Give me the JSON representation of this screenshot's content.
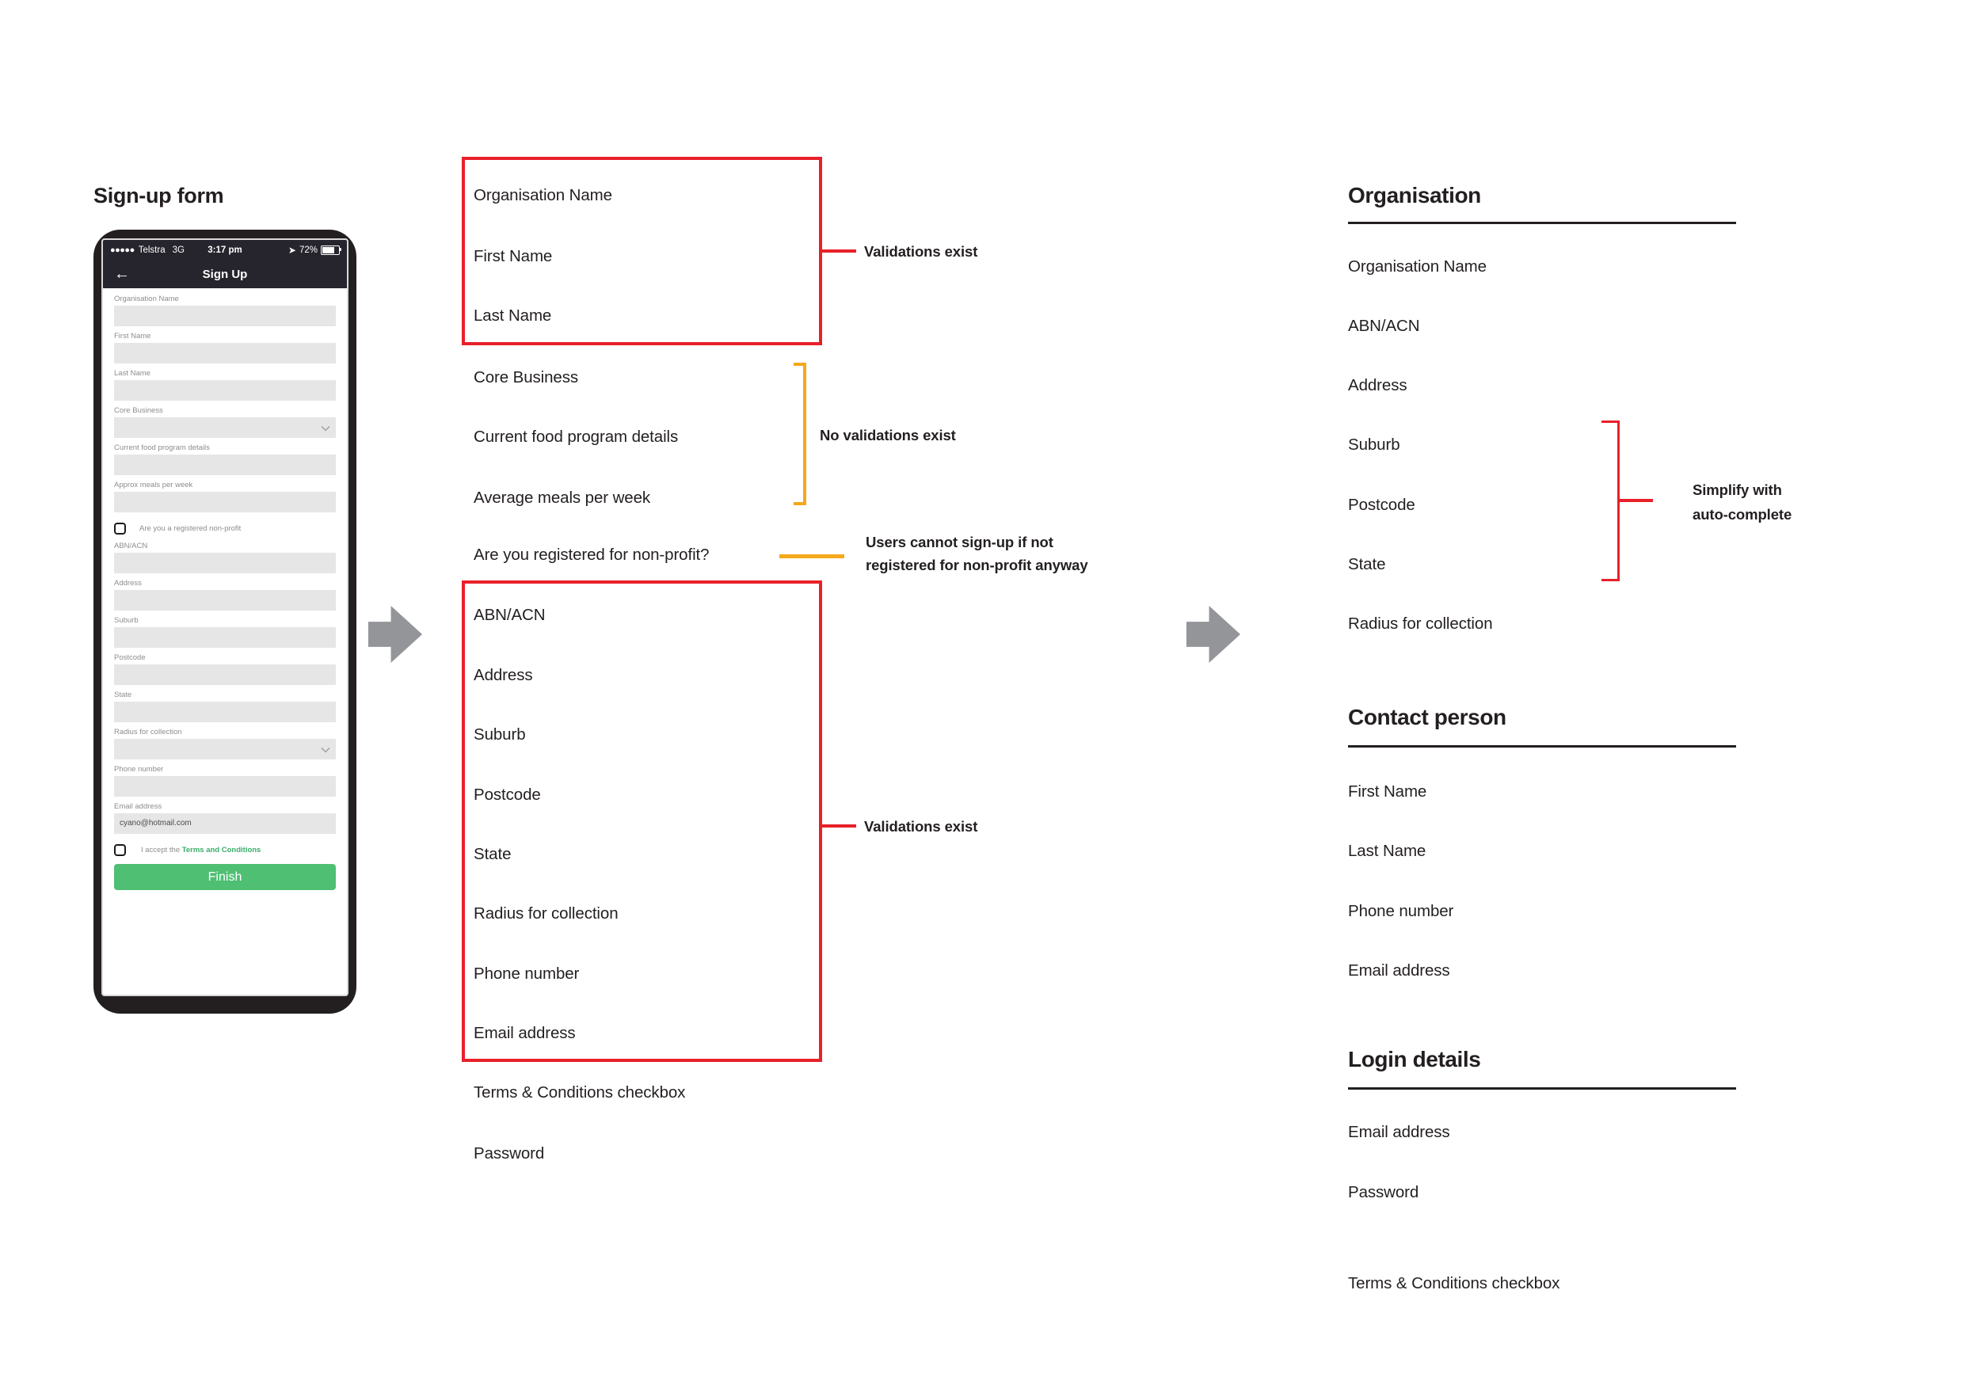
{
  "left": {
    "title": "Sign-up form",
    "phone": {
      "status_bar": {
        "signal_dots": "●●●●●",
        "carrier": "Telstra",
        "network": "3G",
        "time": "3:17 pm",
        "location_icon": "location-arrow-icon",
        "battery_percent": "72%"
      },
      "nav": {
        "back_icon": "back-arrow-icon",
        "title": "Sign Up"
      },
      "fields": [
        {
          "label": "Organisation Name",
          "value": "",
          "type": "text"
        },
        {
          "label": "First Name",
          "value": "",
          "type": "text"
        },
        {
          "label": "Last Name",
          "value": "",
          "type": "text"
        },
        {
          "label": "Core Business",
          "value": "",
          "type": "select"
        },
        {
          "label": "Current food program details",
          "value": "",
          "type": "text"
        },
        {
          "label": "Approx meals per week",
          "value": "",
          "type": "text"
        }
      ],
      "nonprofit_checkbox": {
        "label": "Are you a registered non-profit",
        "checked": false
      },
      "fields2": [
        {
          "label": "ABN/ACN",
          "value": "",
          "type": "text"
        },
        {
          "label": "Address",
          "value": "",
          "type": "text"
        },
        {
          "label": "Suburb",
          "value": "",
          "type": "text"
        },
        {
          "label": "Postcode",
          "value": "",
          "type": "text"
        },
        {
          "label": "State",
          "value": "",
          "type": "text"
        },
        {
          "label": "Radius for collection",
          "value": "",
          "type": "select"
        },
        {
          "label": "Phone number",
          "value": "",
          "type": "text"
        },
        {
          "label": "Email address",
          "value": "cyano@hotmail.com",
          "type": "text"
        }
      ],
      "terms_checkbox": {
        "prefix": "I accept the ",
        "link": "Terms and Conditions",
        "checked": false
      },
      "finish_button": "Finish"
    }
  },
  "middle": {
    "group1": [
      "Organisation Name",
      "First Name",
      "Last Name"
    ],
    "group1_note": "Validations exist",
    "group2": [
      "Core Business",
      "Current food program details",
      "Average meals per week"
    ],
    "group2_note": "No validations exist",
    "group3": [
      "Are you registered for non-profit?"
    ],
    "group3_note_line1": "Users cannot sign-up if not",
    "group3_note_line2": "registered for non-profit anyway",
    "group4": [
      "ABN/ACN",
      "Address",
      "Suburb",
      "Postcode",
      "State",
      "Radius for collection",
      "Phone number",
      "Email address"
    ],
    "group4_note": "Validations exist",
    "group5": [
      "Terms & Conditions checkbox",
      "Password"
    ]
  },
  "right": {
    "sections": [
      {
        "heading": "Organisation",
        "items": [
          "Organisation Name",
          "ABN/ACN",
          "Address",
          "Suburb",
          "Postcode",
          "State",
          "Radius for collection"
        ]
      },
      {
        "heading": "Contact person",
        "items": [
          "First Name",
          "Last Name",
          "Phone number",
          "Email address"
        ]
      },
      {
        "heading": "Login details",
        "items": [
          "Email address",
          "Password",
          "Terms & Conditions checkbox"
        ]
      }
    ],
    "annotation_line1": "Simplify with",
    "annotation_line2": "auto-complete"
  },
  "colors": {
    "red": "#E8202A",
    "orange": "#F5A81C",
    "arrow_grey": "#939598",
    "button_green": "#4FBF73",
    "link_green": "#3AAE6A",
    "phone_body": "#231F20",
    "input_grey": "#E6E6E6"
  },
  "icons": {
    "arrow_1": "right-arrow-icon",
    "arrow_2": "right-arrow-icon"
  }
}
